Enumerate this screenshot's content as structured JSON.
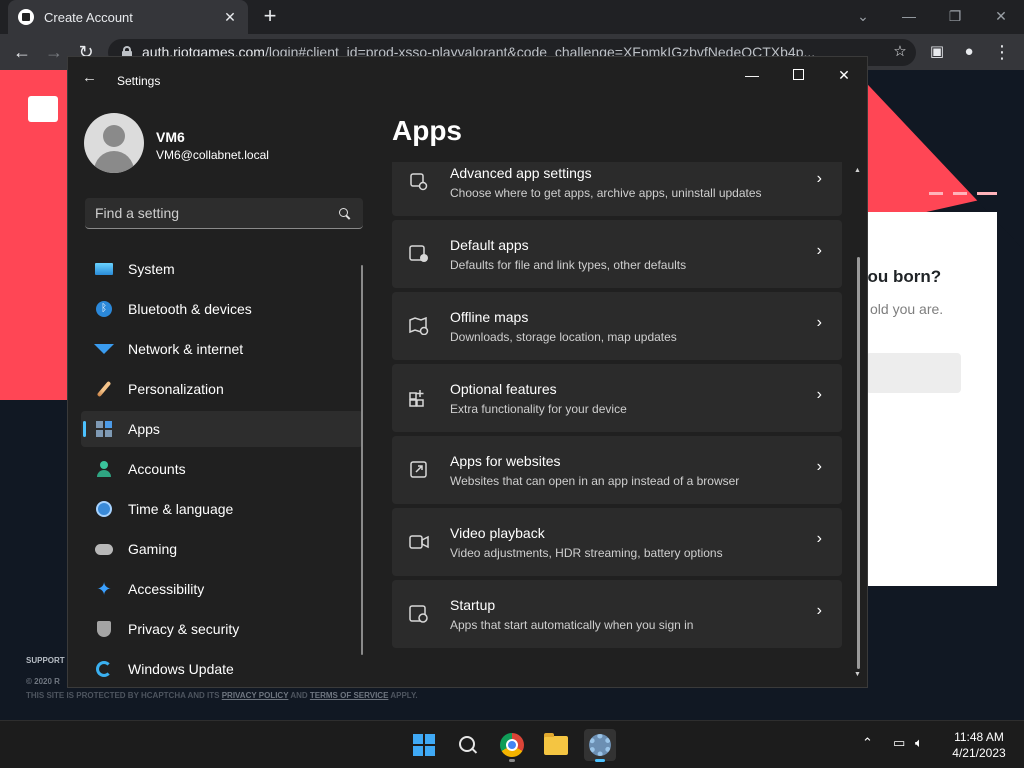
{
  "browser": {
    "tab_title": "Create Account",
    "url_host": "auth.riotgames.com",
    "url_rest": "/login#client_id=prod-xsso-playvalorant&code_challenge=XFpmkIGzbvfNedeOCTXb4p..."
  },
  "riot_page": {
    "question": "you born?",
    "subtitle": "old you are.",
    "support": "SUPPORT",
    "copyright": "© 2020 R",
    "policy_prefix": "THIS SITE IS PROTECTED BY HCAPTCHA AND ITS ",
    "privacy_policy": "PRIVACY POLICY",
    "and": " AND ",
    "terms": "TERMS OF SERVICE",
    "apply": " APPLY."
  },
  "settings": {
    "window_title": "Settings",
    "profile": {
      "name": "VM6",
      "email": "VM6@collabnet.local"
    },
    "search_placeholder": "Find a setting",
    "page_title": "Apps",
    "nav": [
      {
        "label": "System",
        "icon": "system-icon"
      },
      {
        "label": "Bluetooth & devices",
        "icon": "bluetooth-icon"
      },
      {
        "label": "Network & internet",
        "icon": "wifi-icon"
      },
      {
        "label": "Personalization",
        "icon": "brush-icon"
      },
      {
        "label": "Apps",
        "icon": "apps-icon",
        "active": true
      },
      {
        "label": "Accounts",
        "icon": "accounts-icon"
      },
      {
        "label": "Time & language",
        "icon": "time-language-icon"
      },
      {
        "label": "Gaming",
        "icon": "gamepad-icon"
      },
      {
        "label": "Accessibility",
        "icon": "accessibility-icon"
      },
      {
        "label": "Privacy & security",
        "icon": "shield-icon"
      },
      {
        "label": "Windows Update",
        "icon": "update-icon"
      }
    ],
    "cards": [
      {
        "title": "Advanced app settings",
        "desc": "Choose where to get apps, archive apps, uninstall updates",
        "icon": "advanced-app-settings-icon"
      },
      {
        "title": "Default apps",
        "desc": "Defaults for file and link types, other defaults",
        "icon": "default-apps-icon"
      },
      {
        "title": "Offline maps",
        "desc": "Downloads, storage location, map updates",
        "icon": "offline-maps-icon"
      },
      {
        "title": "Optional features",
        "desc": "Extra functionality for your device",
        "icon": "optional-features-icon"
      },
      {
        "title": "Apps for websites",
        "desc": "Websites that can open in an app instead of a browser",
        "icon": "apps-for-websites-icon"
      },
      {
        "title": "Video playback",
        "desc": "Video adjustments, HDR streaming, battery options",
        "icon": "video-playback-icon"
      },
      {
        "title": "Startup",
        "desc": "Apps that start automatically when you sign in",
        "icon": "startup-icon"
      }
    ]
  },
  "taskbar": {
    "time": "11:48 AM",
    "date": "4/21/2023"
  },
  "colors": {
    "accent": "#4cc2ff",
    "riot_red": "#ff4655",
    "settings_bg": "#202020",
    "card_bg": "#2b2b2b"
  }
}
